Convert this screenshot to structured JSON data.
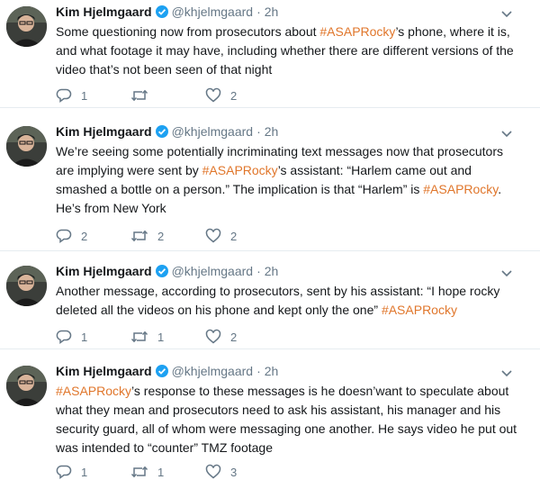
{
  "tweets": [
    {
      "author": "Kim Hjelmgaard",
      "handle": "@khjelmgaard",
      "dot": "·",
      "time": "2h",
      "text_parts": [
        "Some questioning now from prosecutors about ",
        "#ASAPRocky",
        "’s phone, where it is, and what footage it may have, including whether there are different versions of the video that’s not been seen of that night"
      ],
      "replies": "1",
      "retweets": "",
      "likes": "2"
    },
    {
      "author": "Kim Hjelmgaard",
      "handle": "@khjelmgaard",
      "dot": "·",
      "time": "2h",
      "text_parts": [
        "We’re seeing some potentially incriminating text messages now that prosecutors are implying were sent by ",
        "#ASAPRocky",
        "’s assistant: “Harlem came out and smashed a bottle on a person.” The implication is that “Harlem” is ",
        "#ASAPRocky",
        ". He’s from New York"
      ],
      "replies": "2",
      "retweets": "2",
      "likes": "2"
    },
    {
      "author": "Kim Hjelmgaard",
      "handle": "@khjelmgaard",
      "dot": "·",
      "time": "2h",
      "text_parts": [
        "Another message, according to prosecutors, sent by his assistant: “I hope rocky deleted all the videos on his phone and kept only the one” ",
        "#ASAPRocky"
      ],
      "replies": "1",
      "retweets": "1",
      "likes": "2"
    },
    {
      "author": "Kim Hjelmgaard",
      "handle": "@khjelmgaard",
      "dot": "·",
      "time": "2h",
      "text_parts": [
        "#ASAPRocky",
        "’s response to these messages is he doesn’want to speculate about what they mean and prosecutors need to ask his assistant, his manager and his security guard, all of whom were messaging one another. He says video he put out was intended to “counter” TMZ footage"
      ],
      "replies": "1",
      "retweets": "1",
      "likes": "3"
    }
  ],
  "icons": {
    "verified": "verified-badge-icon",
    "caret": "chevron-down-icon",
    "reply": "reply-icon",
    "retweet": "retweet-icon",
    "like": "heart-icon"
  },
  "colors": {
    "hashtag": "#e0762b",
    "verified": "#1da1f2",
    "meta": "#657786",
    "text": "#14171a"
  }
}
